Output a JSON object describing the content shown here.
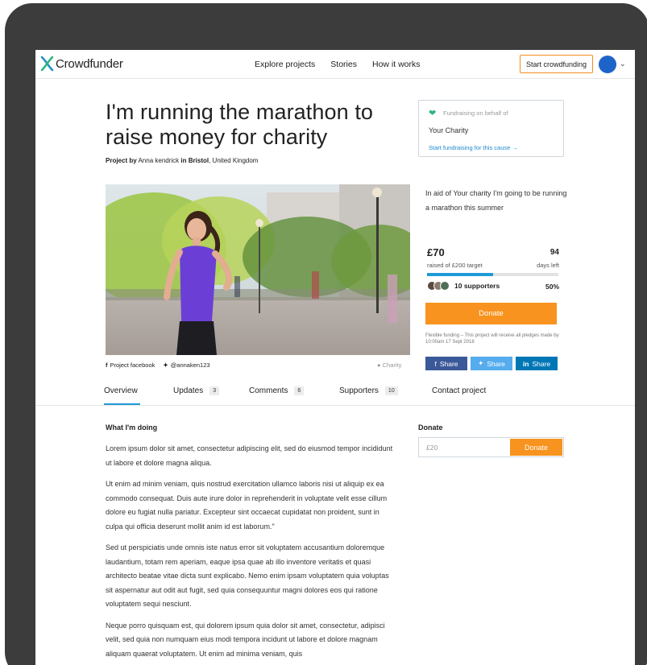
{
  "nav": {
    "brand": "Crowdfunder",
    "links": [
      "Explore projects",
      "Stories",
      "How it works"
    ],
    "cta": "Start crowdfunding",
    "avatar_color": "#1e64c8"
  },
  "project": {
    "title": "I'm running the marathon to raise money for charity",
    "byline_prefix": "Project by",
    "author": "Anna kendrick",
    "byline_in": "in",
    "city": "Bristol",
    "country": ", United Kingdom",
    "image_caption": {
      "facebook": "Project facebook",
      "twitter": "@annaken123",
      "category": "Charity"
    }
  },
  "cause": {
    "label": "Fundraising on behalf of",
    "name": "Your Charity",
    "link": "Start fundraising for this cause →",
    "heart_color": "#2db67c"
  },
  "summary": {
    "aid_text": "In aid of Your charity I'm going to be running a marathon this summer",
    "raised": "£70",
    "raised_sub": "raised of £200 target",
    "days": "94",
    "days_sub": "days left",
    "progress_fraction": 0.5,
    "supporters": "10 supporters",
    "percent": "50%",
    "donate_label": "Donate",
    "flex_note": "Flexible funding – This project will receive all pledges made by 10:00am 17 Sept 2018",
    "shares": [
      {
        "icon": "facebook-icon",
        "label": "Share"
      },
      {
        "icon": "twitter-icon",
        "label": "Share"
      },
      {
        "icon": "linkedin-icon",
        "label": "Share"
      }
    ],
    "accent": "#f7931e",
    "progress_color": "#1f9ad6"
  },
  "tabs": [
    {
      "label": "Overview",
      "count": ""
    },
    {
      "label": "Updates",
      "count": "3"
    },
    {
      "label": "Comments",
      "count": "6"
    },
    {
      "label": "Supporters",
      "count": "10"
    },
    {
      "label": "Contact project",
      "count": ""
    }
  ],
  "content": {
    "heading": "What I'm doing",
    "paragraphs": [
      "Lorem ipsum dolor sit amet, consectetur adipiscing elit, sed do eiusmod tempor incididunt ut labore et dolore magna aliqua.",
      "Ut enim ad minim veniam, quis nostrud exercitation ullamco laboris nisi ut aliquip ex ea commodo consequat. Duis aute irure dolor in reprehenderit in voluptate velit esse cillum dolore eu fugiat nulla pariatur. Excepteur sint occaecat cupidatat non proident, sunt in culpa qui officia deserunt mollit anim id est laborum.\"",
      "Sed ut perspiciatis unde omnis iste natus error sit voluptatem accusantium doloremque laudantium, totam rem aperiam, eaque ipsa quae ab illo inventore veritatis et quasi architecto beatae vitae dicta sunt explicabo. Nemo enim ipsam voluptatem quia voluptas sit aspernatur aut odit aut fugit, sed quia consequuntur magni dolores eos qui ratione voluptatem sequi nesciunt.",
      "Neque porro quisquam est, qui dolorem ipsum quia dolor sit amet, consectetur, adipisci velit, sed quia non numquam eius modi tempora incidunt ut labore et dolore magnam aliquam quaerat voluptatem. Ut enim ad minima veniam, quis"
    ]
  },
  "donate_box": {
    "title": "Donate",
    "placeholder": "£20",
    "button": "Donate"
  }
}
